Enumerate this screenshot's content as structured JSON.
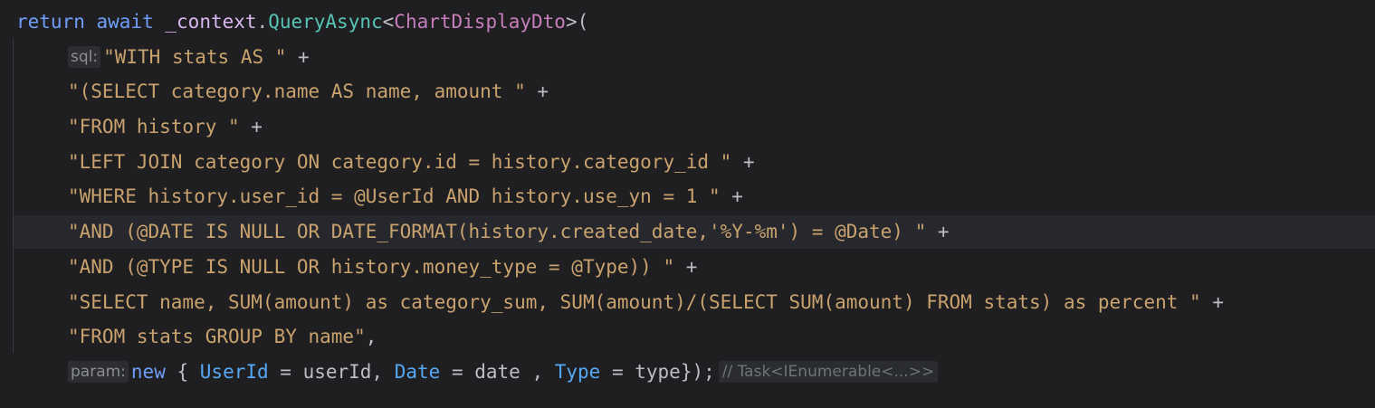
{
  "editor": {
    "line0": {
      "return_kw": "return",
      "await_kw": "await",
      "field": "_context",
      "dot": ".",
      "method": "QueryAsync",
      "open_angle": "<",
      "type_arg": "ChartDisplayDto",
      "close_paren": ">("
    },
    "line1": {
      "hint": "sql:",
      "text": "\"WITH stats AS \"",
      "op": " +"
    },
    "line2": {
      "text": "\"(SELECT category.name AS name, amount \"",
      "op": " +"
    },
    "line3": {
      "text": "\"FROM history \"",
      "op": " +"
    },
    "line4": {
      "text": "\"LEFT JOIN category ON category.id = history.category_id \"",
      "op": " +"
    },
    "line5": {
      "text": "\"WHERE history.user_id = @UserId AND history.use_yn = 1 \"",
      "op": " +"
    },
    "line6": {
      "text": "\"AND (@DATE IS NULL OR DATE_FORMAT(history.created_date,'%Y-%m') = @Date) \"",
      "op": " +"
    },
    "line7": {
      "text": "\"AND (@TYPE IS NULL OR history.money_type = @Type)) \"",
      "op": " +"
    },
    "line8": {
      "text": "\"SELECT name, SUM(amount) as category_sum, SUM(amount)/(SELECT SUM(amount) FROM stats) as percent \"",
      "op": " +"
    },
    "line9": {
      "text": "\"FROM stats GROUP BY name\"",
      "op": ","
    },
    "line10": {
      "hint": "param:",
      "new_kw": "new",
      "open": " { ",
      "prop1": "UserId",
      "eq1": " = userId, ",
      "prop2": "Date",
      "eq2": " = date , ",
      "prop3": "Type",
      "eq3": " = type});",
      "type_hint": "// Task<IEnumerable<...>>"
    }
  }
}
